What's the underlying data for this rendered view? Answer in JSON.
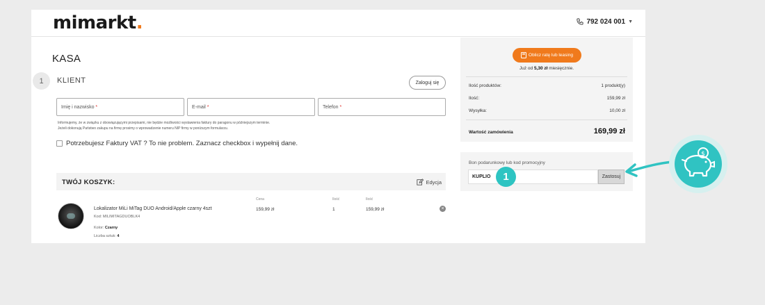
{
  "header": {
    "logo_text": "mimarkt",
    "logo_dot": ".",
    "phone": "792 024 001"
  },
  "checkout": {
    "title": "KASA",
    "step_number": "1",
    "step_title": "KLIENT",
    "login_button": "Zaloguj się"
  },
  "form": {
    "name_placeholder": "Imię i nazwisko",
    "email_placeholder": "E-mail",
    "phone_placeholder": "Telefon",
    "required_mark": "*",
    "info_line1": "Informujemy, że w związku z obowiązującymi przepisami, nie będzie możliwości wystawienia faktury do paragonu w późniejszym terminie.",
    "info_line2": "Jeżeli dokonują Państwo zakupu na firmę prosimy o wprowadzenie numeru NIP firmy w poniższym formularzu.",
    "vat_checkbox_label": "Potrzebujesz Faktury VAT ? To nie problem. Zaznacz checkbox i wypełnij dane."
  },
  "cart": {
    "title": "TWÓJ KOSZYK:",
    "edit_label": "Edycja",
    "columns": [
      "Cena",
      "Ilość",
      "Ilość"
    ],
    "item": {
      "name": "Lokalizator MiLi MiTag DUO Android/Apple czarny 4szt",
      "code": "Kod: MILIMITAGDUOBLK4",
      "color_label": "Kolor:",
      "color_value": "Czarny",
      "qty_label": "Liczba sztuk:",
      "qty_value": "4",
      "price": "159,99 zł",
      "quantity": "1",
      "total": "159,99 zł"
    }
  },
  "summary": {
    "leasing_button": "Oblicz ratę lub leasing",
    "monthly_prefix": "Już od",
    "monthly_amount": "5,30 zł",
    "monthly_suffix": "miesięcznie.",
    "rows": [
      {
        "label": "Ilość produktów:",
        "value": "1 produkt(y)"
      },
      {
        "label": "Ilość:",
        "value": "159,99 zł"
      },
      {
        "label": "Wysyłka:",
        "value": "10,00 zł"
      }
    ],
    "total_label": "Wartość zamówienia",
    "total_value": "169,99 zł"
  },
  "promo": {
    "label": "Bon podarunkowy lub kod promocyjny",
    "input_value": "KUPLIO",
    "apply_button": "Zastosuj",
    "step_badge": "1"
  },
  "colors": {
    "accent_orange": "#f07a1c",
    "accent_teal": "#2ec4c2"
  },
  "icons": {
    "phone": "phone-icon",
    "edit": "edit-icon",
    "calculator": "calculator-icon",
    "remove": "remove-icon",
    "arrow": "arrow-icon",
    "piggy_bank": "piggy-bank-icon"
  }
}
